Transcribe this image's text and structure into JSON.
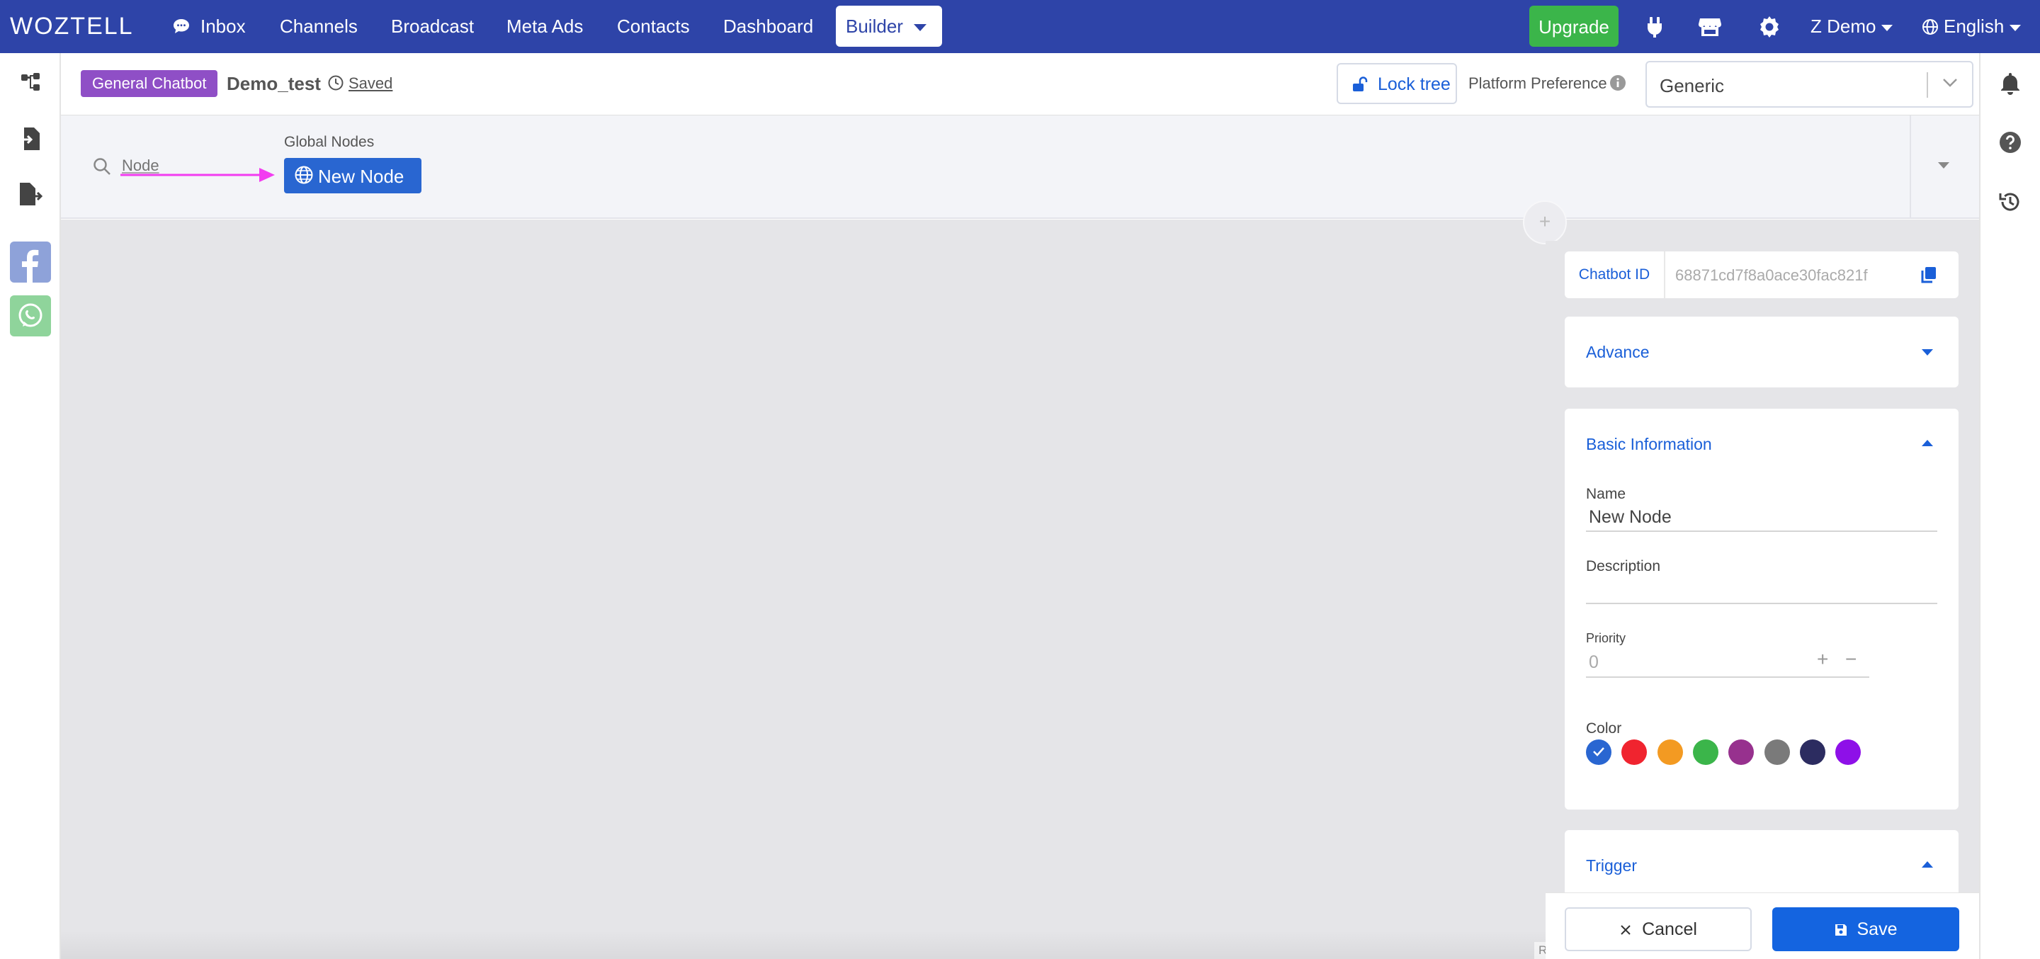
{
  "topnav": {
    "logo": "WOZTELL",
    "items": [
      "Inbox",
      "Channels",
      "Broadcast",
      "Meta Ads",
      "Contacts",
      "Dashboard"
    ],
    "builder_label": "Builder",
    "upgrade_label": "Upgrade",
    "user_label": "Z Demo",
    "language_label": "English",
    "accent_color": "#2e44a8"
  },
  "header": {
    "badge": "General Chatbot",
    "bot_name": "Demo_test",
    "saved_label": "Saved",
    "lock_label": "Lock tree",
    "platform_pref_label": "Platform Preference",
    "platform_pref_value": "Generic"
  },
  "node_bar": {
    "search_placeholder": "Node",
    "global_nodes_label": "Global Nodes",
    "new_node_chip": "New Node"
  },
  "canvas": {
    "watermark": "React Flow",
    "add_button": "+"
  },
  "panel": {
    "chatbot_id_label": "Chatbot ID",
    "chatbot_id_value": "68871cd7f8a0ace30fac821f",
    "advance_title": "Advance",
    "basic_info_title": "Basic Information",
    "name_label": "Name",
    "name_value": "New Node",
    "description_label": "Description",
    "description_value": "",
    "priority_label": "Priority",
    "priority_value": "0",
    "color_label": "Color",
    "colors": [
      "#2966d1",
      "#f0242f",
      "#f39a22",
      "#3bb54a",
      "#97318e",
      "#7a7a7a",
      "#2c2c60",
      "#8e10e8"
    ],
    "selected_color_index": 0,
    "trigger_title": "Trigger"
  },
  "footer": {
    "cancel_label": "Cancel",
    "save_label": "Save"
  }
}
